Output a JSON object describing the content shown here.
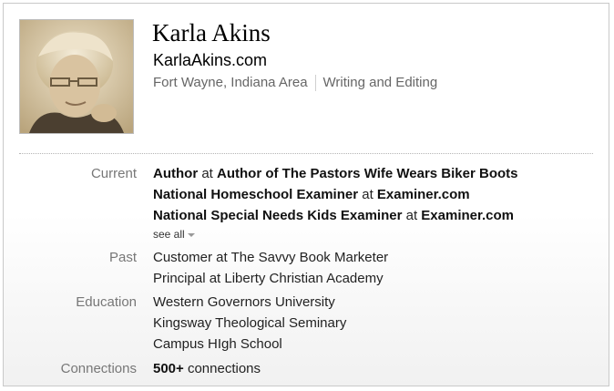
{
  "profile": {
    "name": "Karla Akins",
    "website": "KarlaAkins.com",
    "location": "Fort Wayne, Indiana Area",
    "industry": "Writing and Editing"
  },
  "current": {
    "label": "Current",
    "items": [
      {
        "title": "Author",
        "at": "at",
        "company": "Author of The Pastors Wife Wears Biker Boots"
      },
      {
        "title": "National Homeschool Examiner",
        "at": "at",
        "company": "Examiner.com"
      },
      {
        "title": "National Special Needs Kids Examiner",
        "at": "at",
        "company": "Examiner.com"
      }
    ],
    "see_all": "see all"
  },
  "past": {
    "label": "Past",
    "items": [
      "Customer at The Savvy Book Marketer",
      "Principal at Liberty Christian Academy"
    ]
  },
  "education": {
    "label": "Education",
    "items": [
      "Western Governors University",
      "Kingsway Theological Seminary",
      "Campus HIgh School"
    ]
  },
  "connections": {
    "label": "Connections",
    "count": "500+",
    "suffix": "connections"
  },
  "colors": {
    "photo_tone": "#c9b48c",
    "label_gray": "#777777",
    "meta_gray": "#666666"
  }
}
